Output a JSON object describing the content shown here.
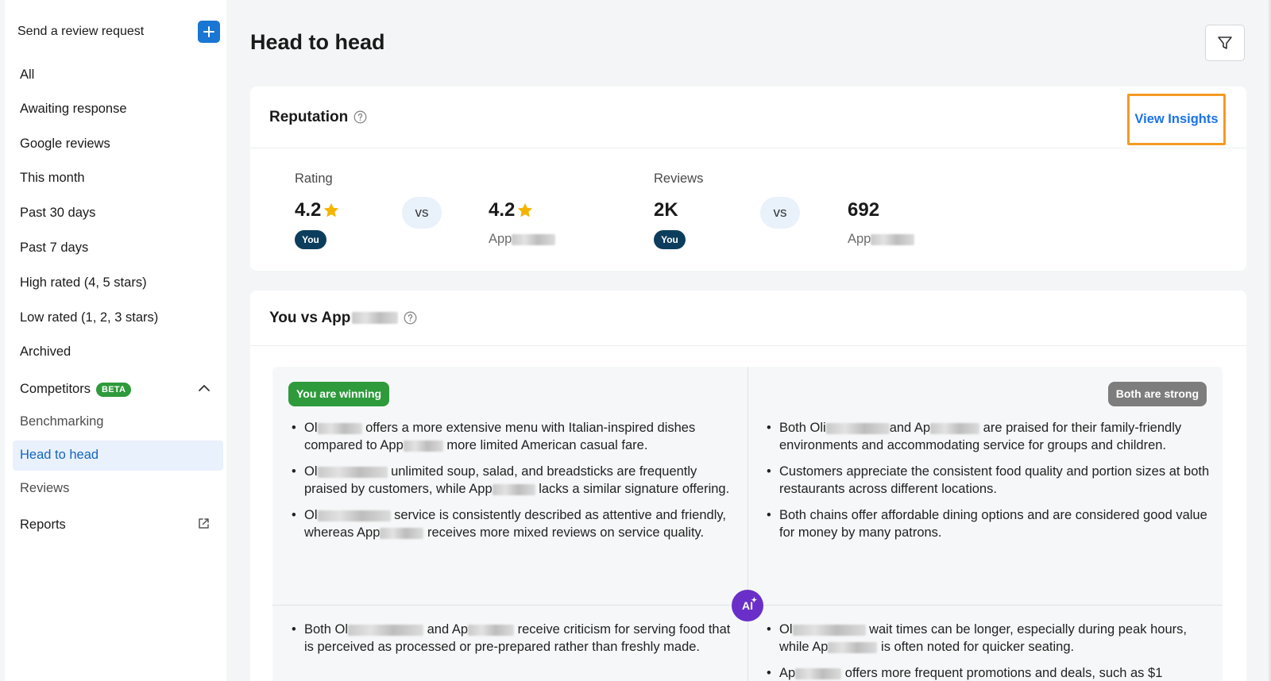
{
  "sidebar": {
    "send_label": "Send a review request",
    "items": [
      {
        "label": "All"
      },
      {
        "label": "Awaiting response"
      },
      {
        "label": "Google reviews"
      },
      {
        "label": "This month"
      },
      {
        "label": "Past 30 days"
      },
      {
        "label": "Past 7 days"
      },
      {
        "label": "High rated (4, 5 stars)"
      },
      {
        "label": "Low rated (1, 2, 3 stars)"
      },
      {
        "label": "Archived"
      }
    ],
    "competitors": {
      "label": "Competitors",
      "badge": "BETA"
    },
    "sub_items": [
      {
        "label": "Benchmarking"
      },
      {
        "label": "Head to head"
      },
      {
        "label": "Reviews"
      }
    ],
    "reports_label": "Reports"
  },
  "page": {
    "title": "Head to head"
  },
  "reputation": {
    "title": "Reputation",
    "view_insights": "View Insights",
    "rating": {
      "label": "Rating",
      "you_value": "4.2",
      "comp_value": "4.2",
      "you_badge": "You",
      "vs": "vs",
      "comp_name": "App"
    },
    "reviews": {
      "label": "Reviews",
      "you_value": "2K",
      "comp_value": "692",
      "you_badge": "You",
      "vs": "vs",
      "comp_name": "App"
    }
  },
  "comparison": {
    "title": "You vs App",
    "winning_tag": "You are winning",
    "strong_tag": "Both are strong",
    "ai_label": "AI",
    "winning_points": [
      {
        "a": "Ol",
        "b": " offers a more extensive menu with Italian-inspired dishes compared to App",
        "c": " more limited American casual fare."
      },
      {
        "a": "Ol",
        "b": " unlimited soup, salad, and breadsticks are frequently praised by customers, while App",
        "c": " lacks a similar signature offering."
      },
      {
        "a": "Ol",
        "b": " service is consistently described as attentive and friendly, whereas App",
        "c": " receives more mixed reviews on service quality."
      }
    ],
    "strong_points": [
      {
        "a": "Both Oli",
        "b": "and Ap",
        "c": " are praised for their family-friendly environments and accommodating service for groups and children."
      },
      {
        "text": "Customers appreciate the consistent food quality and portion sizes at both restaurants across different locations."
      },
      {
        "text": "Both chains offer affordable dining options and are considered good value for money by many patrons."
      }
    ],
    "weak_points": [
      {
        "a": "Both Ol",
        "b": " and Ap",
        "c": " receive criticism for serving food that is perceived as processed or pre-prepared rather than freshly made."
      }
    ],
    "losing_points": [
      {
        "a": "Ol",
        "b": " wait times can be longer, especially during peak hours, while Ap",
        "c": " is often noted for quicker seating."
      },
      {
        "a": "Ap",
        "b": " offers more frequent promotions and deals, such as $1"
      }
    ]
  },
  "colors": {
    "accent": "#1976d2",
    "link": "#1a73e8",
    "highlight_box": "#f59a23",
    "win": "#2e9a3b",
    "strong": "#7d7d7d",
    "ai": "#6a2fc8",
    "star": "#f5b400"
  }
}
